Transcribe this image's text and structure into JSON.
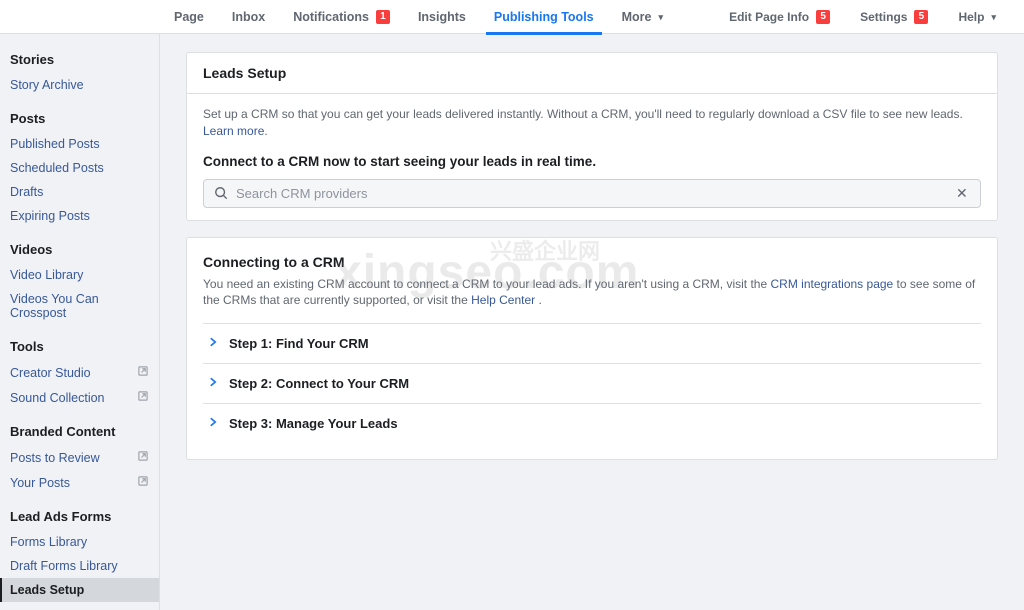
{
  "topnav": {
    "left": [
      {
        "label": "Page"
      },
      {
        "label": "Inbox"
      },
      {
        "label": "Notifications",
        "badge": "1"
      },
      {
        "label": "Insights"
      },
      {
        "label": "Publishing Tools",
        "active": true
      },
      {
        "label": "More",
        "caret": true
      }
    ],
    "right": [
      {
        "label": "Edit Page Info",
        "badge": "5"
      },
      {
        "label": "Settings",
        "badge": "5"
      },
      {
        "label": "Help",
        "caret": true
      }
    ]
  },
  "sidebar": [
    {
      "type": "section",
      "label": "Stories"
    },
    {
      "type": "item",
      "label": "Story Archive"
    },
    {
      "type": "sep"
    },
    {
      "type": "section",
      "label": "Posts"
    },
    {
      "type": "item",
      "label": "Published Posts"
    },
    {
      "type": "item",
      "label": "Scheduled Posts"
    },
    {
      "type": "item",
      "label": "Drafts"
    },
    {
      "type": "item",
      "label": "Expiring Posts"
    },
    {
      "type": "sep"
    },
    {
      "type": "section",
      "label": "Videos"
    },
    {
      "type": "item",
      "label": "Video Library"
    },
    {
      "type": "item",
      "label": "Videos You Can Crosspost"
    },
    {
      "type": "sep"
    },
    {
      "type": "section",
      "label": "Tools"
    },
    {
      "type": "item",
      "label": "Creator Studio",
      "external": true
    },
    {
      "type": "item",
      "label": "Sound Collection",
      "external": true
    },
    {
      "type": "sep"
    },
    {
      "type": "section",
      "label": "Branded Content"
    },
    {
      "type": "item",
      "label": "Posts to Review",
      "external": true
    },
    {
      "type": "item",
      "label": "Your Posts",
      "external": true
    },
    {
      "type": "sep"
    },
    {
      "type": "section",
      "label": "Lead Ads Forms"
    },
    {
      "type": "item",
      "label": "Forms Library"
    },
    {
      "type": "item",
      "label": "Draft Forms Library"
    },
    {
      "type": "item",
      "label": "Leads Setup",
      "selected": true
    }
  ],
  "leads": {
    "title": "Leads Setup",
    "desc_pre": "Set up a CRM so that you can get your leads delivered instantly. Without a CRM, you'll need to regularly download a CSV file to see new leads. ",
    "learn_more": "Learn more",
    "connect_heading": "Connect to a CRM now to start seeing your leads in real time.",
    "search_placeholder": "Search CRM providers"
  },
  "crm": {
    "title": "Connecting to a CRM",
    "desc_pre": "You need an existing CRM account to connect a CRM to your lead ads. If you aren't using a CRM, visit the ",
    "integrations_link": "CRM integrations page",
    "desc_mid": " to see some of the CRMs that are currently supported, or visit the ",
    "help_link": "Help Center",
    "desc_end": " .",
    "steps": [
      {
        "label": "Step 1: Find Your CRM"
      },
      {
        "label": "Step 2: Connect to Your CRM"
      },
      {
        "label": "Step 3: Manage Your Leads"
      }
    ]
  },
  "watermark": "xingseo.com",
  "watermark_cn": "兴盛企业网"
}
